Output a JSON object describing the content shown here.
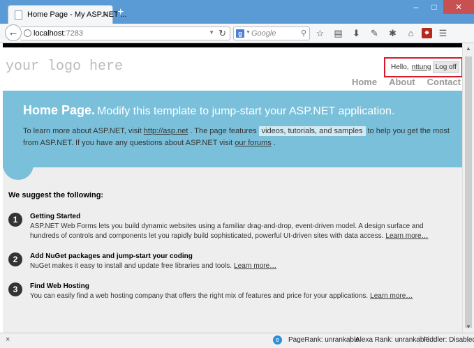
{
  "browser": {
    "tab_title": "Home Page - My ASP.NET ...",
    "tab_close": "×",
    "new_tab": "+",
    "window_controls": {
      "minimize": "–",
      "maximize": "□",
      "close": "✕"
    },
    "url_host": "localhost",
    "url_port": ":7283",
    "search_placeholder": "Google",
    "search_engine_letter": "g",
    "toolbar_icons": [
      "star-icon",
      "reading-list-icon",
      "download-icon",
      "pen-icon",
      "tools-icon",
      "home-icon",
      "firebug-icon",
      "menu-icon"
    ]
  },
  "site": {
    "logo": "your logo here",
    "login": {
      "hello": "Hello,",
      "username": "nttung",
      "suffix": "!",
      "logoff": "Log off"
    },
    "menu": [
      "Home",
      "About",
      "Contact"
    ],
    "featured": {
      "title_bold": "Home Page.",
      "title_rest": "Modify this template to jump-start your ASP.NET application.",
      "text_1": "To learn more about ASP.NET, visit",
      "link_1": "http://asp.net",
      "text_2": ". The page features",
      "highlight": "videos, tutorials, and samples",
      "text_3": "to help you get the most from ASP.NET. If you have any questions about ASP.NET visit",
      "link_2": "our forums",
      "text_4": "."
    },
    "suggest_title": "We suggest the following:",
    "steps": [
      {
        "num": "1",
        "title": "Getting Started",
        "body": "ASP.NET Web Forms lets you build dynamic websites using a familiar drag-and-drop, event-driven model. A design surface and hundreds of controls and components let you rapidly build sophisticated, powerful UI-driven sites with data access.",
        "link": "Learn more…"
      },
      {
        "num": "2",
        "title": "Add NuGet packages and jump-start your coding",
        "body": "NuGet makes it easy to install and update free libraries and tools.",
        "link": "Learn more…"
      },
      {
        "num": "3",
        "title": "Find Web Hosting",
        "body": "You can easily find a web hosting company that offers the right mix of features and price for your applications.",
        "link": "Learn more…"
      }
    ]
  },
  "status": {
    "close": "×",
    "pagerank": "PageRank: unrankable",
    "alexa": "Alexa Rank: unrankable",
    "fiddler": "Fiddler: Disabled"
  },
  "colors": {
    "featured_bg": "#7ac0da",
    "titlebar_bg": "#5b9bd5",
    "login_border": "#d91a2a"
  }
}
